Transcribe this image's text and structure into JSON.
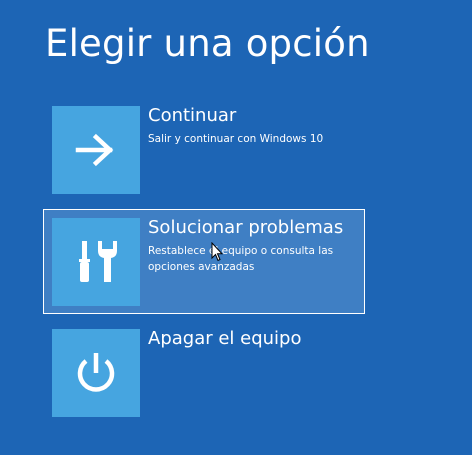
{
  "page": {
    "title": "Elegir una opción"
  },
  "options": [
    {
      "title": "Continuar",
      "description": "Salir y continuar con Windows 10",
      "icon": "arrow-right-icon",
      "selected": false
    },
    {
      "title": "Solucionar problemas",
      "description": "Restablece el equipo o consulta las opciones avanzadas",
      "icon": "tools-icon",
      "selected": true
    },
    {
      "title": "Apagar el equipo",
      "description": "",
      "icon": "power-icon",
      "selected": false
    }
  ],
  "colors": {
    "background": "#1d65b5",
    "tile": "#46a5e0",
    "selected_background": "#3f7fc4",
    "text": "#ffffff"
  }
}
